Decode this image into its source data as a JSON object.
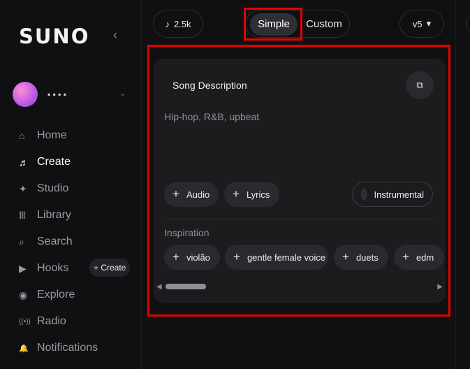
{
  "app": {
    "logo": "SUNO",
    "collapse_glyph": "‹"
  },
  "user": {
    "name": "▪ ▪ ▪ ▪",
    "chevron": "⌄"
  },
  "nav": {
    "items": [
      {
        "label": "Home",
        "icon": "home-icon",
        "glyph": "⌂"
      },
      {
        "label": "Create",
        "icon": "create-music-icon",
        "glyph": "♬"
      },
      {
        "label": "Studio",
        "icon": "studio-icon",
        "glyph": "✦"
      },
      {
        "label": "Library",
        "icon": "library-icon",
        "glyph": "Ⅲ"
      },
      {
        "label": "Search",
        "icon": "search-icon",
        "glyph": "⌕"
      },
      {
        "label": "Hooks",
        "icon": "hooks-icon",
        "glyph": "▶"
      },
      {
        "label": "Explore",
        "icon": "explore-icon",
        "glyph": "◉"
      },
      {
        "label": "Radio",
        "icon": "radio-icon",
        "glyph": "((•))"
      },
      {
        "label": "Notifications",
        "icon": "bell-icon",
        "glyph": "🔔"
      }
    ],
    "hooks_create_label": "+ Create"
  },
  "topbar": {
    "credits": "2.5k",
    "credits_icon": "♪",
    "mode_simple": "Simple",
    "mode_custom": "Custom",
    "version": "v5",
    "version_chevron": "▾"
  },
  "card": {
    "title": "Song Description",
    "shuffle_glyph": "⧉",
    "description_placeholder": "Hip-hop, R&B, upbeat",
    "audio_label": "Audio",
    "lyrics_label": "Lyrics",
    "instrumental_label": "Instrumental",
    "inspiration_label": "Inspiration",
    "inspiration_tags": [
      "violão",
      "gentle female voice",
      "duets",
      "edm"
    ]
  },
  "colors": {
    "background": "#101012",
    "card": "#1c1c1f",
    "chip": "#2a2a2e",
    "highlight": "#e60000"
  }
}
